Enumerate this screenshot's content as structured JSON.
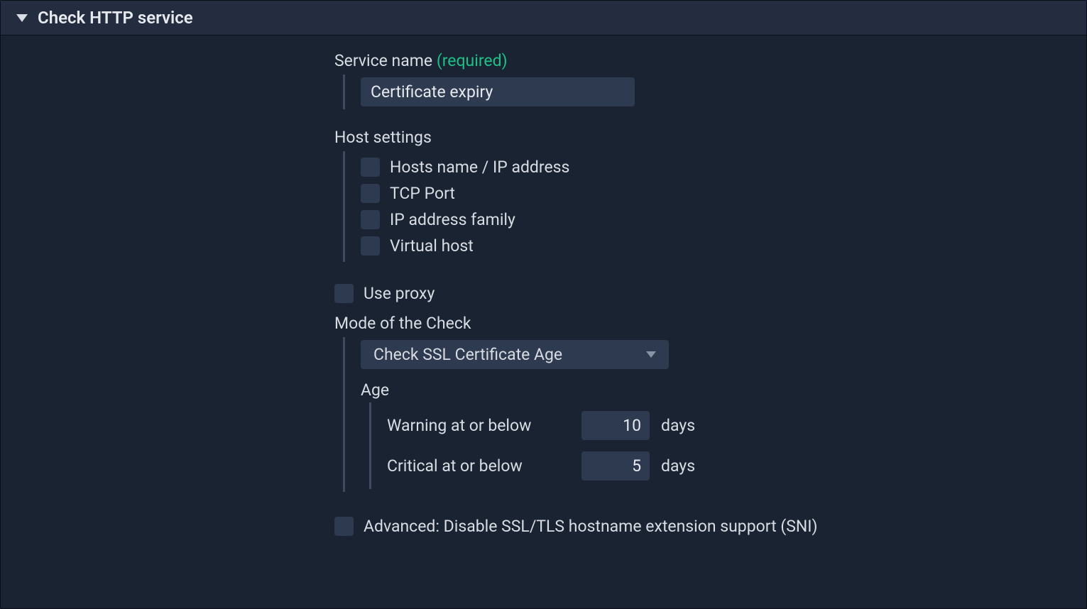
{
  "header": {
    "title": "Check HTTP service"
  },
  "service_name": {
    "label": "Service name",
    "required_text": "(required)",
    "value": "Certificate expiry"
  },
  "host_settings": {
    "title": "Host settings",
    "items": [
      "Hosts name / IP address",
      "TCP Port",
      "IP address family",
      "Virtual host"
    ]
  },
  "use_proxy": {
    "label": "Use proxy"
  },
  "mode": {
    "title": "Mode of the Check",
    "selected": "Check SSL Certificate Age"
  },
  "age": {
    "title": "Age",
    "warning_label": "Warning at or below",
    "warning_value": "10",
    "critical_label": "Critical at or below",
    "critical_value": "5",
    "unit": "days"
  },
  "advanced": {
    "label": "Advanced: Disable SSL/TLS hostname extension support (SNI)"
  }
}
